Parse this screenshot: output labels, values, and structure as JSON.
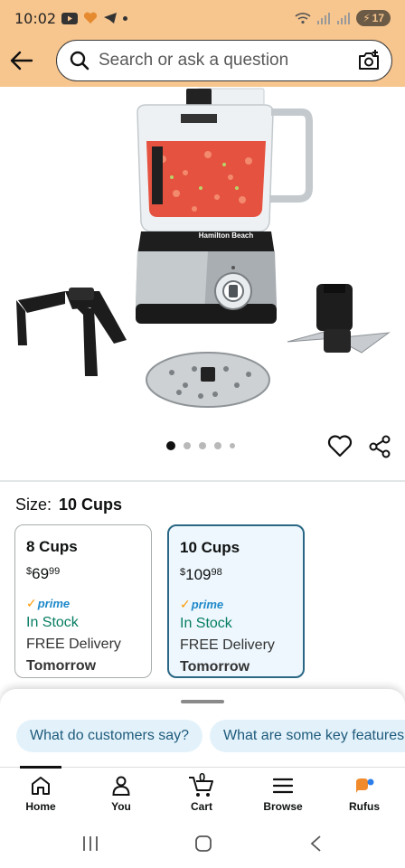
{
  "status_bar": {
    "time": "10:02",
    "battery": "17"
  },
  "search": {
    "placeholder": "Search or ask a question"
  },
  "product": {
    "brand_on_image": "Hamilton Beach",
    "carousel_total": 5,
    "carousel_active": 1
  },
  "size": {
    "label": "Size:",
    "selected": "10 Cups"
  },
  "options": [
    {
      "title": "8 Cups",
      "price_symbol": "$",
      "price_whole": "69",
      "price_cents": "99",
      "prime": "prime",
      "stock": "In Stock",
      "delivery": "FREE Delivery",
      "when": "Tomorrow",
      "selected": false
    },
    {
      "title": "10 Cups",
      "price_symbol": "$",
      "price_whole": "109",
      "price_cents": "98",
      "prime": "prime",
      "stock": "In Stock",
      "delivery": "FREE Delivery",
      "when": "Tomorrow",
      "selected": true
    }
  ],
  "suggestions": [
    "What do customers say?",
    "What are some key features"
  ],
  "bottom_nav": [
    {
      "label": "Home",
      "icon": "home-icon"
    },
    {
      "label": "You",
      "icon": "person-icon"
    },
    {
      "label": "Cart",
      "icon": "cart-icon",
      "count": "0"
    },
    {
      "label": "Browse",
      "icon": "menu-icon"
    },
    {
      "label": "Rufus",
      "icon": "rufus-icon"
    }
  ],
  "colors": {
    "header_bg": "#f7c58e",
    "selected_border": "#2a6784",
    "stock_green": "#067d62",
    "prime_blue": "#1e88c9",
    "chip_bg": "#e3f2fa"
  }
}
